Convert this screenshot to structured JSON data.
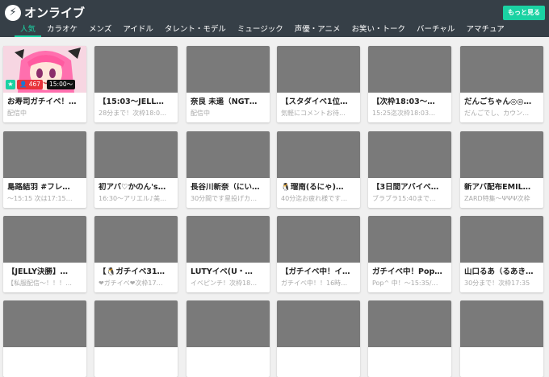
{
  "app": {
    "logo_glyph": "⚡",
    "title": "オンライブ",
    "more_label": "もっと見る",
    "accent_color": "#1bd2a3",
    "header_color": "#363f47"
  },
  "tabs": [
    {
      "label": "人気",
      "active": true
    },
    {
      "label": "カラオケ"
    },
    {
      "label": "メンズ"
    },
    {
      "label": "アイドル"
    },
    {
      "label": "タレント・モデル"
    },
    {
      "label": "ミュージック"
    },
    {
      "label": "声優・アニメ"
    },
    {
      "label": "お笑い・トーク"
    },
    {
      "label": "バーチャル"
    },
    {
      "label": "アマチュア"
    }
  ],
  "cards": [
    {
      "title": "お寿司ガチイベ！…",
      "sub": "配信中",
      "featured": true,
      "star": "★",
      "viewers": "467",
      "viewer_icon": "👤",
      "time": "15:00〜"
    },
    {
      "title": "【15:03〜JELL…",
      "sub": "28分まで！次枠18:0…"
    },
    {
      "title": "奈良 未遥（NGT…",
      "sub": "配信中"
    },
    {
      "title": "【スタダイベ1位…",
      "sub": "気軽にコメントお待…"
    },
    {
      "title": "【次枠18:03〜…",
      "sub": "15:25迄次枠18:03…"
    },
    {
      "title": "だんごちゃん◎◎…",
      "sub": "だんごでし、カウン…"
    },
    {
      "title": "島路結羽 #フレ…",
      "sub": "〜15:15 次は17:15…"
    },
    {
      "title": "初アバ♡かのん's…",
      "sub": "16:30〜アリエル♪美…"
    },
    {
      "title": "長谷川新奈（にい…",
      "sub": "30分間です星投げカ…"
    },
    {
      "title": "🐧瑠南(るにゃ)…",
      "sub": "40分迄お疲れ様です…"
    },
    {
      "title": "【3日間アバイベ…",
      "sub": "ブラブラ15:40まで…"
    },
    {
      "title": "新アバ配布EMIL…",
      "sub": "ZARD特集〜ΨΨΨ次枠"
    },
    {
      "title": "【JELLY決勝】…",
      "sub": "【私服配信〜！！！…"
    },
    {
      "title": "【🐧ガチイベ31…",
      "sub": "❤ガチイベ❤次枠17…"
    },
    {
      "title": "LUTYイベ(ᑌ・…",
      "sub": "イベピンチ！次枠18…"
    },
    {
      "title": "【ガチイベ中！イ…",
      "sub": "ガチイベ中！！16時…"
    },
    {
      "title": "ガチイベ中！Pop…",
      "sub": "Pop^ 中！〜15:35/…"
    },
    {
      "title": "山口るあ（るあき…",
      "sub": "30分まで！次枠17:35"
    },
    {
      "title": "",
      "sub": ""
    },
    {
      "title": "",
      "sub": ""
    },
    {
      "title": "",
      "sub": ""
    },
    {
      "title": "",
      "sub": ""
    },
    {
      "title": "",
      "sub": ""
    },
    {
      "title": "",
      "sub": ""
    }
  ]
}
